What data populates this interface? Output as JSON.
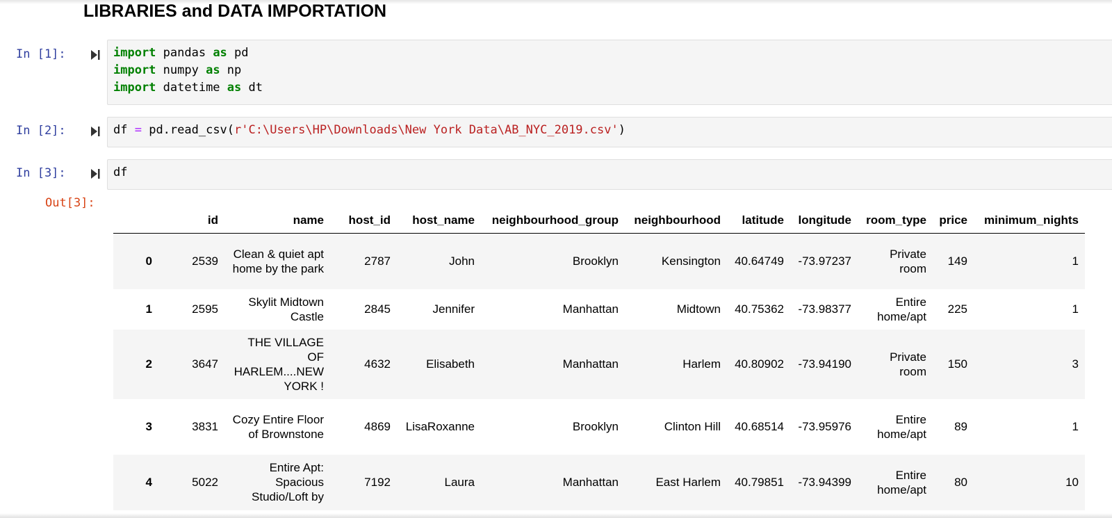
{
  "heading": "LIBRARIES and DATA IMPORTATION",
  "cells": [
    {
      "prompt": "In [1]:",
      "lines": [
        [
          {
            "t": "kw",
            "v": "import"
          },
          {
            "t": "n",
            "v": " pandas "
          },
          {
            "t": "kw",
            "v": "as"
          },
          {
            "t": "n",
            "v": " pd"
          }
        ],
        [
          {
            "t": "kw",
            "v": "import"
          },
          {
            "t": "n",
            "v": " numpy "
          },
          {
            "t": "kw",
            "v": "as"
          },
          {
            "t": "n",
            "v": " np"
          }
        ],
        [
          {
            "t": "kw",
            "v": "import"
          },
          {
            "t": "n",
            "v": " datetime "
          },
          {
            "t": "kw",
            "v": "as"
          },
          {
            "t": "n",
            "v": " dt"
          }
        ]
      ]
    },
    {
      "prompt": "In [2]:",
      "lines": [
        [
          {
            "t": "n",
            "v": "df "
          },
          {
            "t": "op",
            "v": "="
          },
          {
            "t": "n",
            "v": " pd.read_csv("
          },
          {
            "t": "str",
            "v": "r'C:\\Users\\HP\\Downloads\\New York Data\\AB_NYC_2019.csv'"
          },
          {
            "t": "n",
            "v": ")"
          }
        ]
      ]
    },
    {
      "prompt": "In [3]:",
      "lines": [
        [
          {
            "t": "n",
            "v": "df"
          }
        ]
      ]
    }
  ],
  "output_prompt": "Out[3]:",
  "table": {
    "columns": [
      "",
      "id",
      "name",
      "host_id",
      "host_name",
      "neighbourhood_group",
      "neighbourhood",
      "latitude",
      "longitude",
      "room_type",
      "price",
      "minimum_nights"
    ],
    "rows": [
      [
        "0",
        "2539",
        "Clean & quiet apt home by the park",
        "2787",
        "John",
        "Brooklyn",
        "Kensington",
        "40.64749",
        "-73.97237",
        "Private room",
        "149",
        "1"
      ],
      [
        "1",
        "2595",
        "Skylit Midtown Castle",
        "2845",
        "Jennifer",
        "Manhattan",
        "Midtown",
        "40.75362",
        "-73.98377",
        "Entire home/apt",
        "225",
        "1"
      ],
      [
        "2",
        "3647",
        "THE VILLAGE OF HARLEM....NEW YORK !",
        "4632",
        "Elisabeth",
        "Manhattan",
        "Harlem",
        "40.80902",
        "-73.94190",
        "Private room",
        "150",
        "3"
      ],
      [
        "3",
        "3831",
        "Cozy Entire Floor of Brownstone",
        "4869",
        "LisaRoxanne",
        "Brooklyn",
        "Clinton Hill",
        "40.68514",
        "-73.95976",
        "Entire home/apt",
        "89",
        "1"
      ],
      [
        "4",
        "5022",
        "Entire Apt: Spacious Studio/Loft by",
        "7192",
        "Laura",
        "Manhattan",
        "East Harlem",
        "40.79851",
        "-73.94399",
        "Entire home/apt",
        "80",
        "10"
      ]
    ]
  }
}
